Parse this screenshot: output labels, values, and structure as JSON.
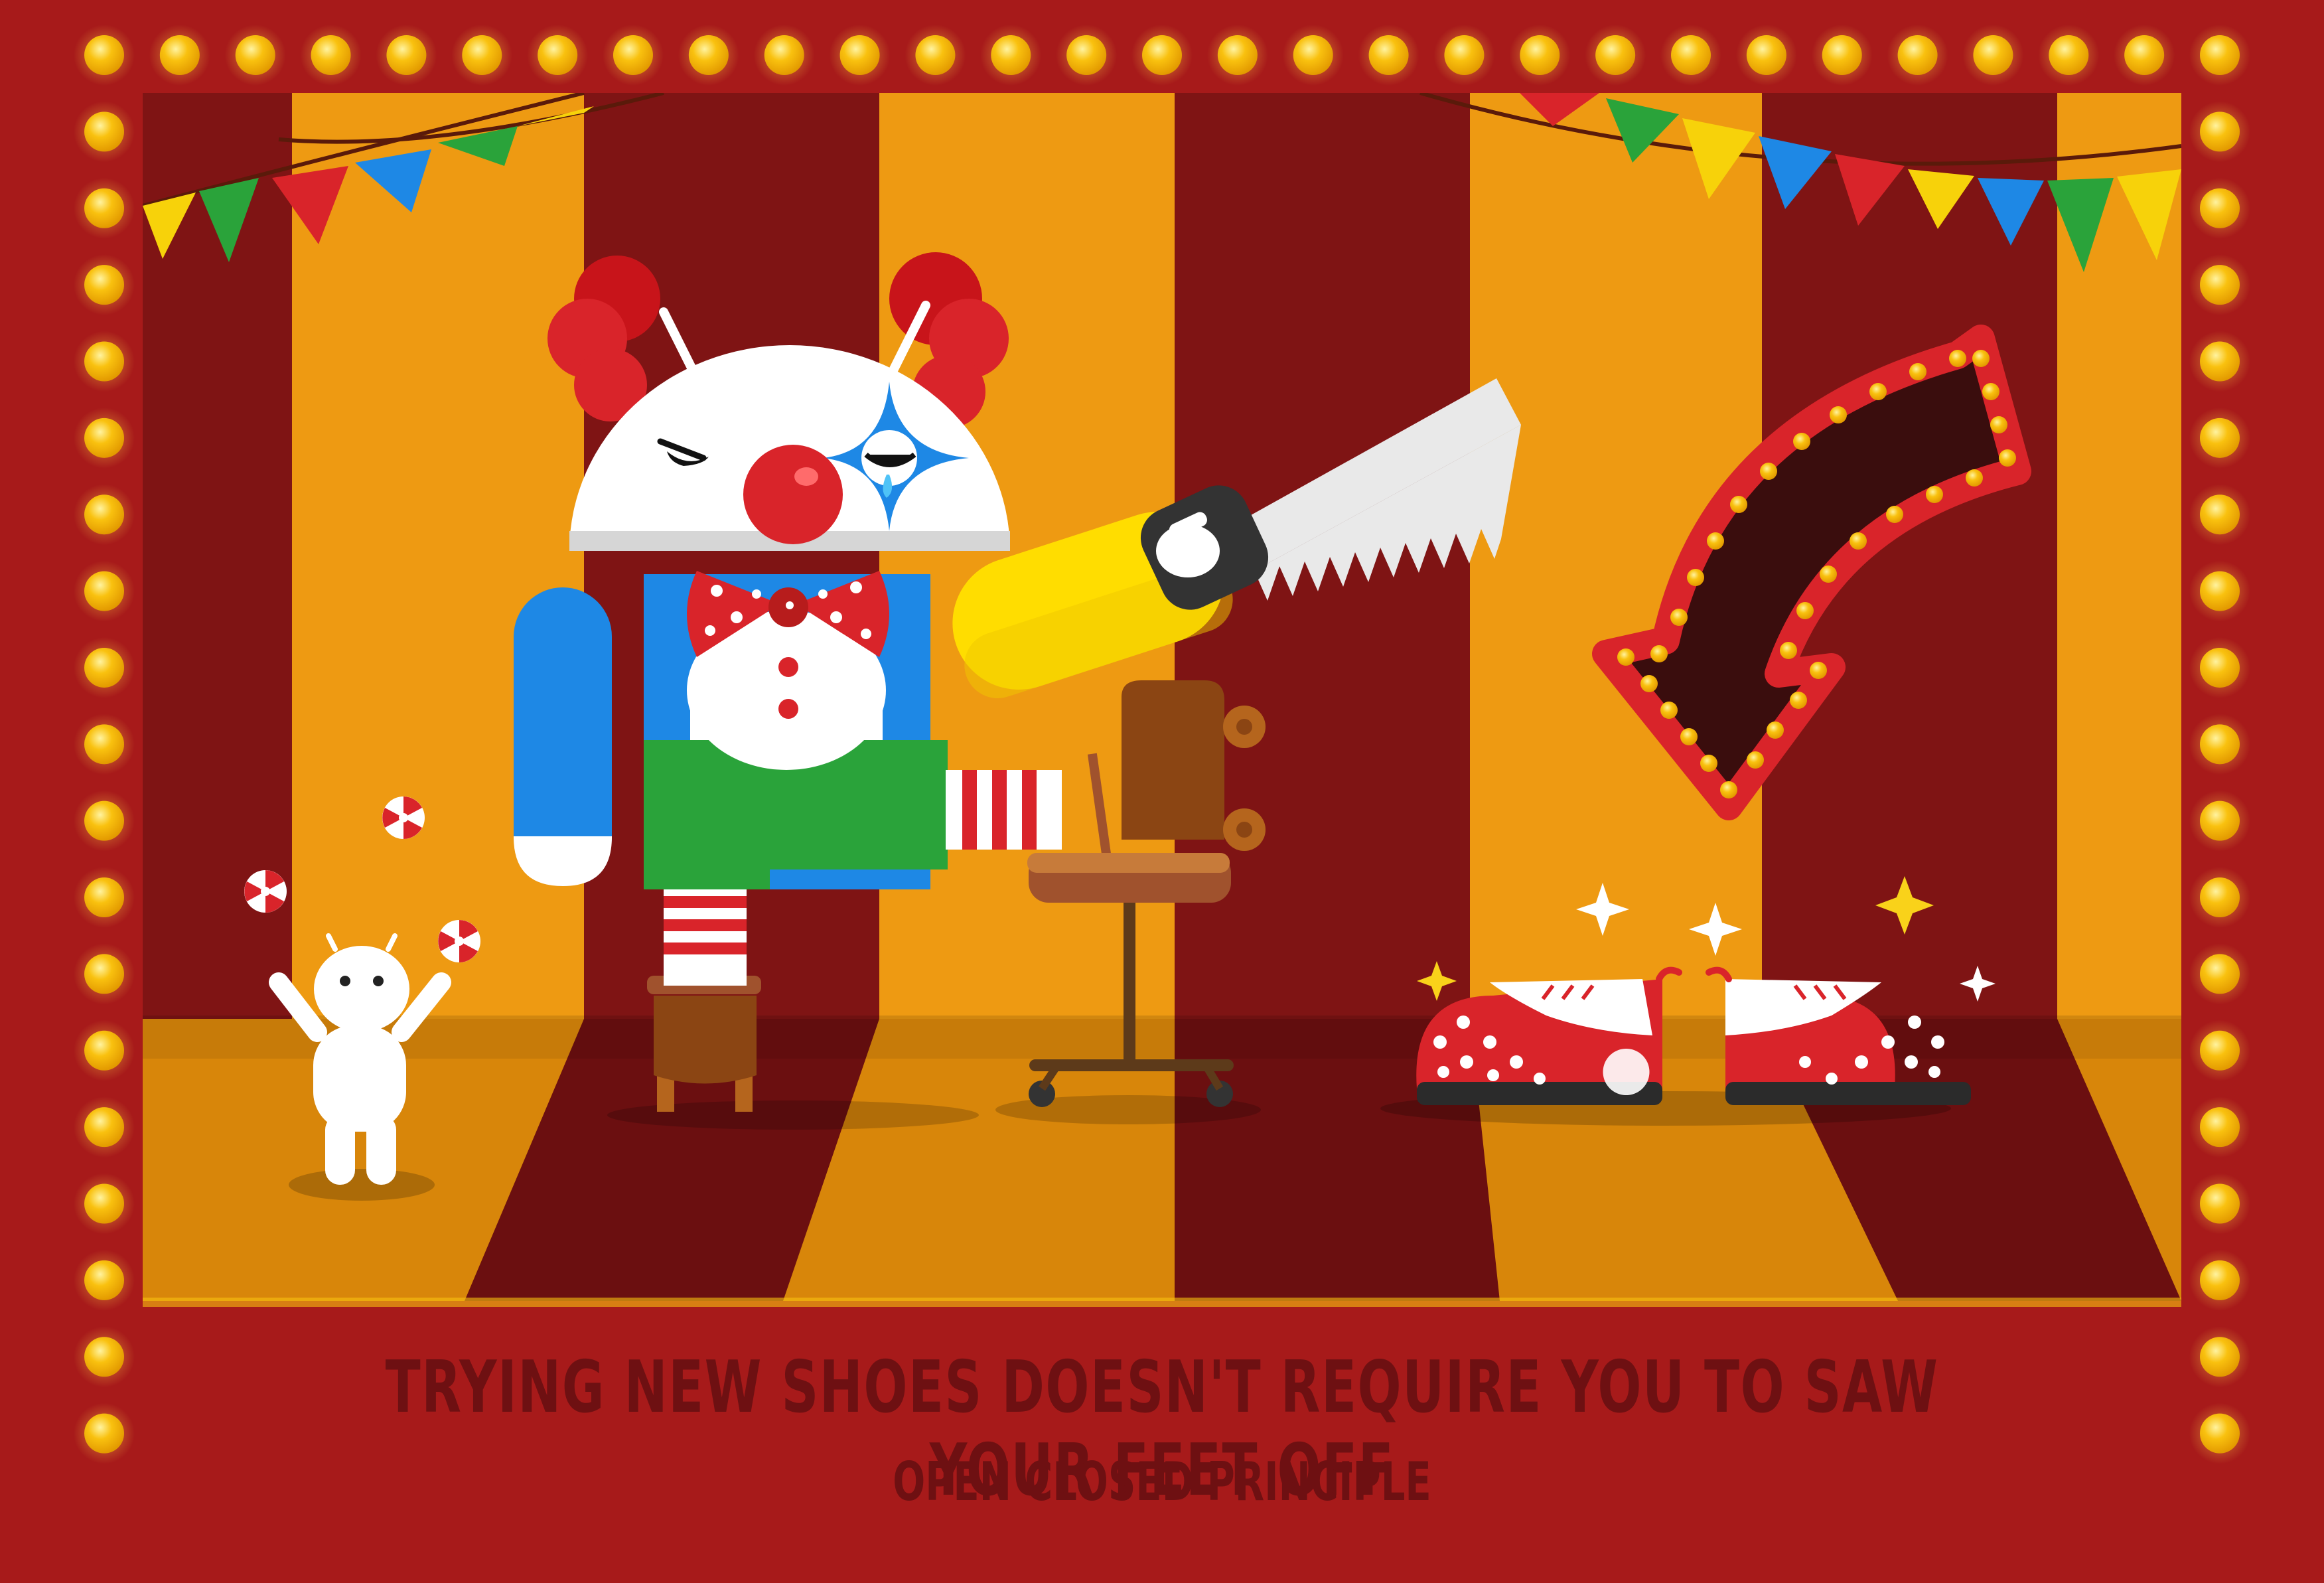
{
  "caption": {
    "title": "TRYING NEW SHOES DOESN'T REQUIRE YOU TO SAW YOUR FEET OFF",
    "subtitle": "OPEN CLOSED PRINCIPLE"
  },
  "colors": {
    "frame_red": "#a71a1a",
    "stripe_dark": "#7f1414",
    "stripe_orange": "#ee9a12",
    "floor_dark": "#6b0f10",
    "floor_orange": "#d8860a",
    "bulb_yellow": "#f9c10f",
    "caption_text": "#6e1012"
  },
  "icons": [
    "marquee-bulb",
    "bunting-flag",
    "clown-robot",
    "hand-saw",
    "office-chair",
    "marquee-arrow",
    "clown-shoes",
    "small-android-robot",
    "peppermint-candy",
    "sparkle"
  ]
}
